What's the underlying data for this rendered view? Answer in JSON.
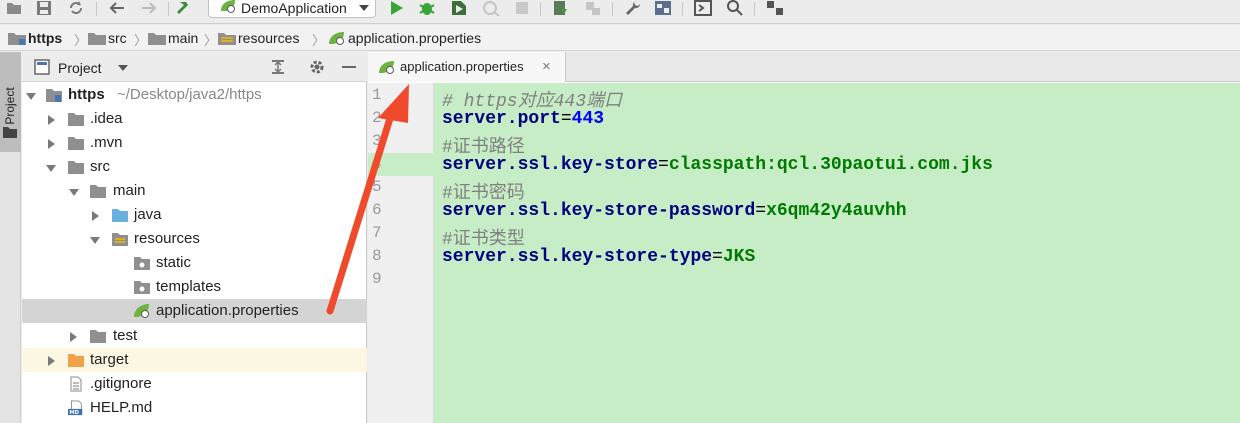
{
  "toolbar": {
    "run_config": "DemoApplication"
  },
  "breadcrumb": [
    "https",
    "src",
    "main",
    "resources",
    "application.properties"
  ],
  "sidebar_stripe": {
    "label": "1: Project"
  },
  "project_panel": {
    "title": "Project",
    "root_name": "https",
    "root_path": "~/Desktop/java2/https",
    "items": [
      {
        "label": ".idea"
      },
      {
        "label": ".mvn"
      },
      {
        "label": "src"
      },
      {
        "label": "main"
      },
      {
        "label": "java"
      },
      {
        "label": "resources"
      },
      {
        "label": "static"
      },
      {
        "label": "templates"
      },
      {
        "label": "application.properties"
      },
      {
        "label": "test"
      },
      {
        "label": "target"
      },
      {
        "label": ".gitignore"
      },
      {
        "label": "HELP.md"
      }
    ],
    "md_badge": "MD"
  },
  "editor": {
    "tab_label": "application.properties",
    "line_numbers": [
      "1",
      "2",
      "3",
      "4",
      "5",
      "6",
      "7",
      "8",
      "9"
    ],
    "lines": [
      {
        "comment": "# https对应443端口"
      },
      {
        "key": "server.port",
        "eq": "=",
        "value": "443"
      },
      {
        "comment": "#证书路径"
      },
      {
        "key": "server.ssl.key-store",
        "eq": "=",
        "value": "classpath:qcl.30paotui.com.jks"
      },
      {
        "comment": "#证书密码"
      },
      {
        "key": "server.ssl.key-store-password",
        "eq": "=",
        "value": "x6qm42y4auvhh"
      },
      {
        "comment": "#证书类型"
      },
      {
        "key": "server.ssl.key-store-type",
        "eq": "=",
        "value": "JKS"
      }
    ]
  },
  "colors": {
    "editor_bg": "#c6edc6",
    "key": "#000080",
    "value": "#007a00",
    "number": "#0000ff",
    "comment": "#808080",
    "arrow": "#f04a2c"
  }
}
